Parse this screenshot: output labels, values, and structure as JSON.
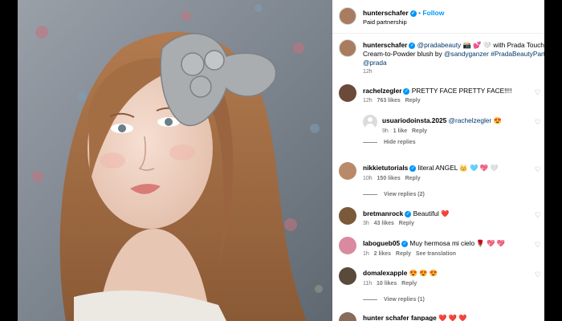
{
  "header": {
    "username": "hunterschafer",
    "follow_label": "Follow",
    "subtitle": "Paid partnership"
  },
  "caption": {
    "username": "hunterschafer",
    "line1_tag": "@pradabeauty",
    "line1_rest": "📸 💕 🤍 with Prada Touch",
    "line2_a": "Cream-to-Powder blush by ",
    "line2_tag1": "@sandyganzer",
    "line2_tag2": " #PradaBeautyPartner",
    "line3_tag": "@prada",
    "time": "12h"
  },
  "comments": [
    {
      "username": "rachelzegler",
      "text": "PRETTY FACE PRETTY FACE!!!!",
      "time": "12h",
      "likes": "763 likes",
      "reply": "Reply",
      "avatar_color": "#6b4a3a"
    },
    {
      "username": "nikkietutorials",
      "text": "literal ANGEL 👑 🩵 💖 🤍",
      "time": "10h",
      "likes": "150 likes",
      "reply": "Reply",
      "avatar_color": "#b88a6a"
    },
    {
      "username": "bretmanrock",
      "text": "Beautiful ❤️",
      "time": "3h",
      "likes": "43 likes",
      "reply": "Reply",
      "avatar_color": "#7a5a3a"
    },
    {
      "username": "labogueb05",
      "text": "Muy hermosa mi cielo 🌹 💖 💖",
      "time": "1h",
      "likes": "2 likes",
      "reply": "Reply",
      "extra": "See translation",
      "avatar_color": "#d98aa0"
    },
    {
      "username": "domalexapple",
      "text": "😍 😍 😍",
      "time": "11h",
      "likes": "10 likes",
      "reply": "Reply",
      "avatar_color": "#5a4a3a"
    },
    {
      "username": "hunter schafer fanpage",
      "text": "❤️ ❤️ ❤️",
      "avatar_color": "#8a6a5a"
    }
  ],
  "reply1": {
    "username": "usuariodoinsta.2025",
    "tag": "@rachelzegler",
    "emoji": "😍",
    "time": "9h",
    "likes": "1 like",
    "reply": "Reply"
  },
  "hide_replies": "Hide replies",
  "view_replies_2": "View replies (2)",
  "view_replies_1": "View replies (1)",
  "photo_next": "›"
}
